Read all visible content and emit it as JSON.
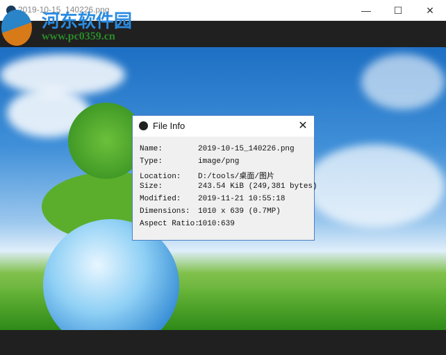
{
  "window": {
    "title": "2019-10-15_140226.png",
    "minimize": "—",
    "maximize": "☐",
    "close": "✕"
  },
  "watermark": {
    "name": "河东软件园",
    "url": "www.pc0359.cn"
  },
  "dialog": {
    "title": "File Info",
    "close": "✕",
    "rows": [
      {
        "key": "Name:",
        "value": "2019-10-15_140226.png"
      },
      {
        "key": "Type:",
        "value": "image/png"
      },
      {
        "key": "Location:",
        "value": "D:/tools/桌面/图片"
      },
      {
        "key": "Size:",
        "value": "243.54 KiB (249,381 bytes)"
      },
      {
        "key": "Modified:",
        "value": "2019-11-21 10:55:18"
      },
      {
        "key": "Dimensions:",
        "value": "1010 x 639 (0.7MP)"
      },
      {
        "key": "Aspect Ratio:",
        "value": "1010:639"
      }
    ]
  }
}
